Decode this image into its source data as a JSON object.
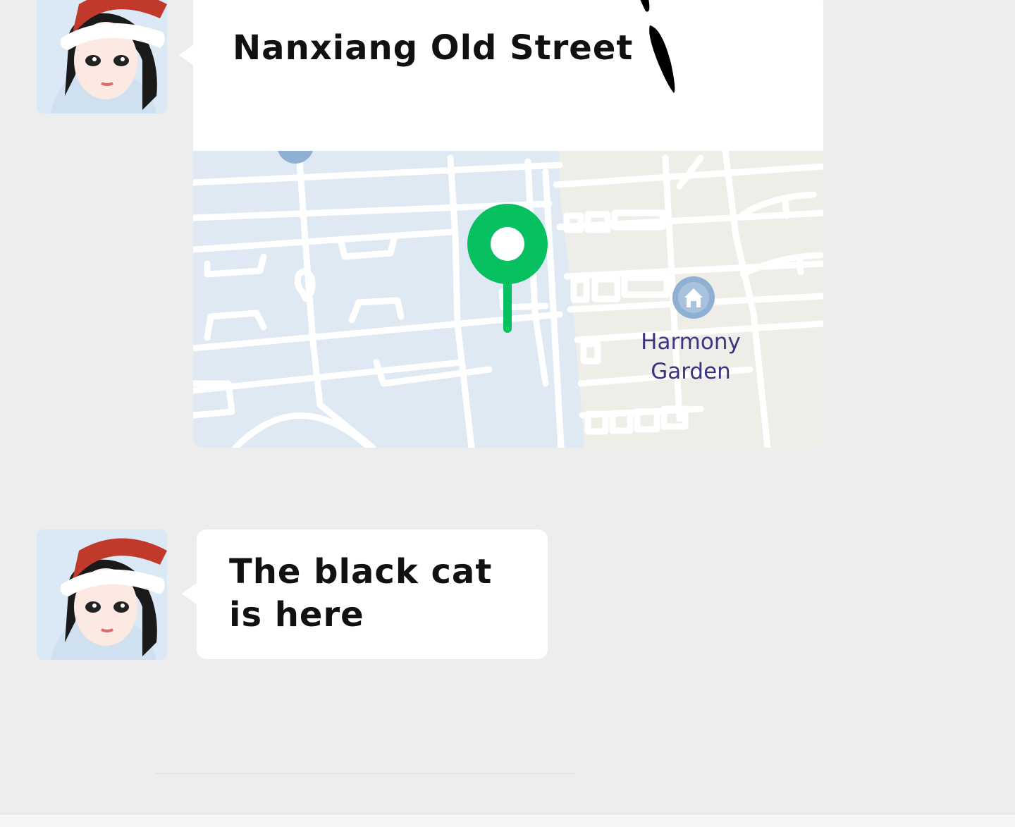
{
  "messages": [
    {
      "type": "location",
      "title": "Nanxiang Old Street",
      "poi_label": "Harmony\nGarden",
      "pin_color": "#07c160"
    },
    {
      "type": "text",
      "text": "The black cat\nis here"
    }
  ],
  "colors": {
    "background": "#ededed",
    "bubble": "#ffffff",
    "map_water_blocks": "#dfe9f4",
    "map_land_blocks": "#f0eeea",
    "pin": "#07c160",
    "poi_icon": "#8fb0d3",
    "poi_text": "#3b3580"
  },
  "icons": {
    "pin": "location-pin-icon",
    "poi": "house-icon"
  }
}
